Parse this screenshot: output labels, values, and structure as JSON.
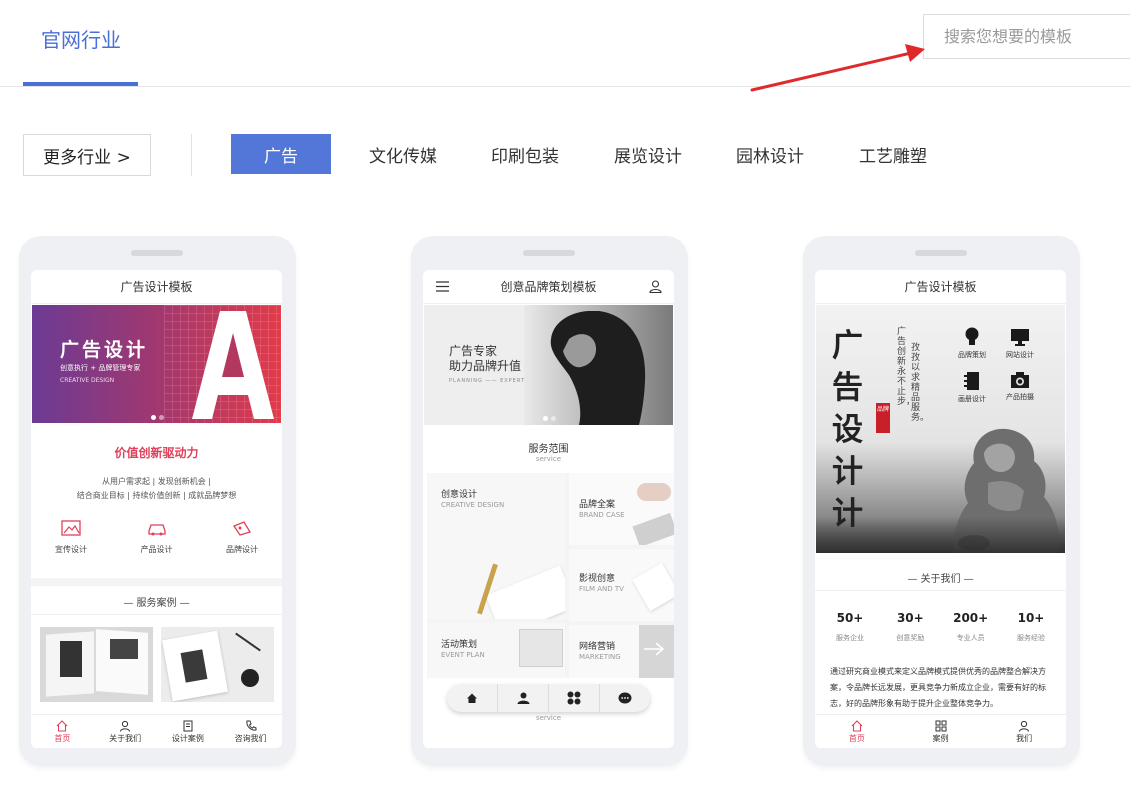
{
  "header": {
    "active_tab": "官网行业",
    "search_placeholder": "搜索您想要的模板"
  },
  "filter": {
    "more_label": "更多行业 >",
    "categories": [
      "广告",
      "文化传媒",
      "印刷包装",
      "展览设计",
      "园林设计",
      "工艺雕塑"
    ],
    "active_category": "广告"
  },
  "colors": {
    "accent": "#4a6fd8",
    "active_cat": "#5377d8",
    "pink": "#e0405a"
  },
  "templates": [
    {
      "title": "广告设计模板",
      "banner_title": "广告设计",
      "banner_sub": "创意执行 + 品牌管理专家",
      "banner_en": "CREATIVE DESIGN",
      "banner_letter": "A",
      "slogan": "价值创新驱动力",
      "desc_line1": "从用户需求起 | 发现创新机会 |",
      "desc_line2": "结合商业目标 | 持续价值创新 | 成就品牌梦想",
      "services": [
        "宣传设计",
        "产品设计",
        "品牌设计"
      ],
      "cases_heading": "— 服务案例 —",
      "nav": [
        "首页",
        "关于我们",
        "设计案例",
        "咨询我们"
      ]
    },
    {
      "title": "创意品牌策划模板",
      "banner_line1": "广告专家",
      "banner_line2": "助力品牌升值",
      "banner_en": "PLANNING —— EXPERT",
      "section_title": "服务范围",
      "section_en": "service",
      "tiles": [
        {
          "cn": "创意设计",
          "en": "CREATIVE DESIGN"
        },
        {
          "cn": "品牌全案",
          "en": "BRAND CASE"
        },
        {
          "cn": "影视创意",
          "en": "FILM AND TV"
        },
        {
          "cn": "活动策划",
          "en": "EVENT PLAN"
        },
        {
          "cn": "网络营销",
          "en": "MARKETING"
        }
      ],
      "footer_en": "service"
    },
    {
      "title": "广告设计模板",
      "poster_big": "广告设计计",
      "poster_vertical1": "广告创新永不止步，",
      "poster_vertical2": "孜孜以求精品服务。",
      "stamp": "品牌",
      "icons": [
        "品牌策划",
        "网站设计",
        "画册设计",
        "产品拍摄"
      ],
      "about_heading": "— 关于我们 —",
      "stats": [
        {
          "value": "50+",
          "label": "服务企业"
        },
        {
          "value": "30+",
          "label": "创意奖励"
        },
        {
          "value": "200+",
          "label": "专业人员"
        },
        {
          "value": "10+",
          "label": "服务经验"
        }
      ],
      "para": "通过研究商业模式来定义品牌模式提供优秀的品牌整合解决方案，令品牌长远发展，更具竞争力新成立企业，需要有好的标志，好的品牌形象有助于提升企业整体竞争力。",
      "nav": [
        "首页",
        "案例",
        "我们"
      ]
    }
  ]
}
